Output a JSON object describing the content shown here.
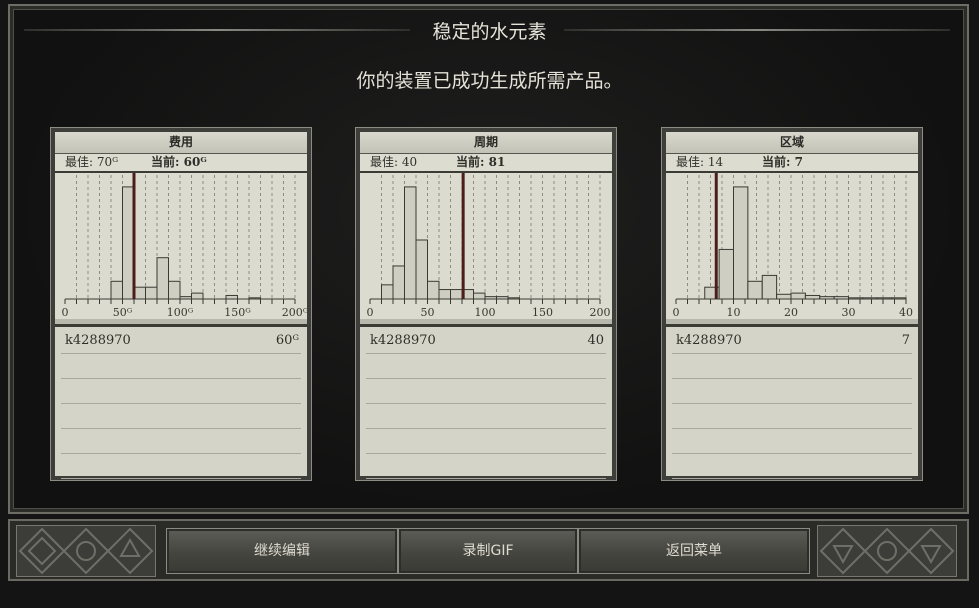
{
  "header": {
    "title": "稳定的水元素",
    "subtitle": "你的装置已成功生成所需产品。"
  },
  "panels": [
    {
      "title": "费用",
      "best_label": "最佳:",
      "best_value": "70ᴳ",
      "current_label": "当前:",
      "current_value": "60ᴳ",
      "entry_name": "k4288970",
      "entry_value": "60ᴳ",
      "tick_labels": [
        "0",
        "50ᴳ",
        "100ᴳ",
        "150ᴳ",
        "200ᴳ"
      ]
    },
    {
      "title": "周期",
      "best_label": "最佳:",
      "best_value": "40",
      "current_label": "当前:",
      "current_value": "81",
      "entry_name": "k4288970",
      "entry_value": "40",
      "tick_labels": [
        "0",
        "50",
        "100",
        "150",
        "200"
      ]
    },
    {
      "title": "区域",
      "best_label": "最佳:",
      "best_value": "14",
      "current_label": "当前:",
      "current_value": "7",
      "entry_name": "k4288970",
      "entry_value": "7",
      "tick_labels": [
        "0",
        "10",
        "20",
        "30",
        "40"
      ]
    }
  ],
  "buttons": {
    "continue_edit": "继续编辑",
    "record_gif": "录制GIF",
    "back_to_menu": "返回菜单"
  },
  "chart_data": [
    {
      "type": "histogram",
      "title": "费用",
      "xlim": [
        0,
        200
      ],
      "bin_width": 10,
      "marker": 60,
      "counts": [
        0,
        0,
        0,
        0,
        0.15,
        0.95,
        0.1,
        0.1,
        0.35,
        0.15,
        0.02,
        0.05,
        0,
        0,
        0.03,
        0,
        0.01,
        0,
        0,
        0
      ]
    },
    {
      "type": "histogram",
      "title": "周期",
      "xlim": [
        0,
        200
      ],
      "bin_width": 10,
      "marker": 81,
      "counts": [
        0,
        0.12,
        0.28,
        0.95,
        0.5,
        0.15,
        0.08,
        0.08,
        0.08,
        0.05,
        0.02,
        0.02,
        0.01,
        0,
        0,
        0,
        0,
        0,
        0,
        0
      ]
    },
    {
      "type": "histogram",
      "title": "区域",
      "xlim": [
        0,
        40
      ],
      "bin_width": 2.5,
      "marker": 7,
      "counts": [
        0,
        0,
        0.1,
        0.42,
        0.95,
        0.15,
        0.2,
        0.04,
        0.05,
        0.03,
        0.02,
        0.02,
        0.01,
        0.01,
        0.01,
        0.01
      ]
    }
  ]
}
